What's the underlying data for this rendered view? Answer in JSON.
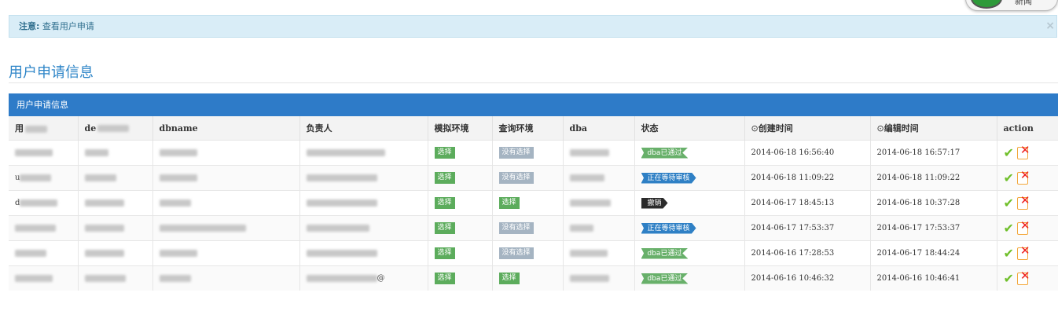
{
  "alert": {
    "label": "注意:",
    "text": "查看用户申请",
    "close": "×"
  },
  "corner": {
    "text": "新闻"
  },
  "page_title": "用户申请信息",
  "panel": {
    "title": "用户申请信息"
  },
  "columns": [
    "用",
    "de",
    "dbname",
    "负责人",
    "模拟环境",
    "查询环境",
    "dba",
    "状态",
    "创建时间",
    "编辑时间",
    "action"
  ],
  "clock_glyph": "⊙",
  "rows": [
    {
      "prefix": "",
      "sim": "选择",
      "query": "没有选择",
      "query_style": "grey",
      "status": "dba已通过",
      "status_style": "green",
      "created": "2014-06-18 16:56:40",
      "edited": "2014-06-18 16:57:17",
      "resp_suffix": ""
    },
    {
      "prefix": "u",
      "sim": "选择",
      "query": "没有选择",
      "query_style": "grey",
      "status": "正在等待审核",
      "status_style": "blue",
      "created": "2014-06-18 11:09:22",
      "edited": "2014-06-18 11:09:22",
      "resp_suffix": ""
    },
    {
      "prefix": "d",
      "sim": "选择",
      "query": "选择",
      "query_style": "green",
      "status": "撤销",
      "status_style": "black",
      "created": "2014-06-17 18:45:13",
      "edited": "2014-06-18 10:37:28",
      "resp_suffix": ""
    },
    {
      "prefix": "",
      "sim": "选择",
      "query": "没有选择",
      "query_style": "grey",
      "status": "正在等待审核",
      "status_style": "blue",
      "created": "2014-06-17 17:53:37",
      "edited": "2014-06-17 17:53:37",
      "resp_suffix": ""
    },
    {
      "prefix": "",
      "sim": "选择",
      "query": "没有选择",
      "query_style": "grey",
      "status": "dba已通过",
      "status_style": "green",
      "created": "2014-06-16 17:28:53",
      "edited": "2014-06-17 18:44:24",
      "resp_suffix": ""
    },
    {
      "prefix": "",
      "sim": "选择",
      "query": "选择",
      "query_style": "green",
      "status": "dba已通过",
      "status_style": "green",
      "created": "2014-06-16 10:46:32",
      "edited": "2014-06-16 10:46:41",
      "resp_suffix": "@"
    }
  ],
  "colors": {
    "accent": "#2e7bc8",
    "alert_bg": "#d9edf7",
    "title": "#2f86c8"
  },
  "icons": {
    "check": "check-icon",
    "cancel": "cancel-icon"
  }
}
